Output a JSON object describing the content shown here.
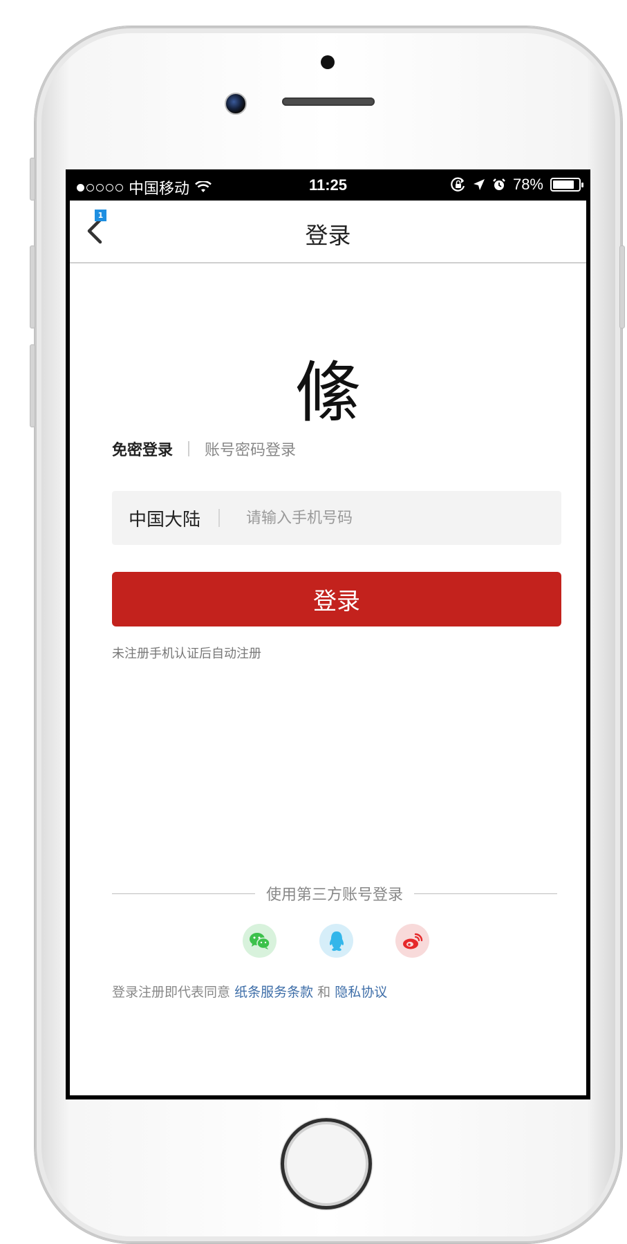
{
  "statusbar": {
    "carrier": "中国移动",
    "time": "11:25",
    "battery": "78%",
    "battery_level": 0.78,
    "signal_bars": 1,
    "signal_total": 5
  },
  "nav": {
    "title": "登录",
    "badge": "1"
  },
  "logo_text": "絛",
  "tabs": {
    "active": "免密登录",
    "inactive": "账号密码登录"
  },
  "phone_field": {
    "region": "中国大陆",
    "placeholder": "请输入手机号码"
  },
  "login_button": "登录",
  "note": "未注册手机认证后自动注册",
  "third_party": {
    "label": "使用第三方账号登录",
    "icons": [
      "wechat-icon",
      "qq-icon",
      "weibo-icon"
    ]
  },
  "terms": {
    "prefix": "登录注册即代表同意",
    "link1": "纸条服务条款",
    "and": "和",
    "link2": "隐私协议"
  },
  "colors": {
    "accent": "#c3221d",
    "link": "#3e6ea8",
    "badge": "#1e8fe1"
  }
}
